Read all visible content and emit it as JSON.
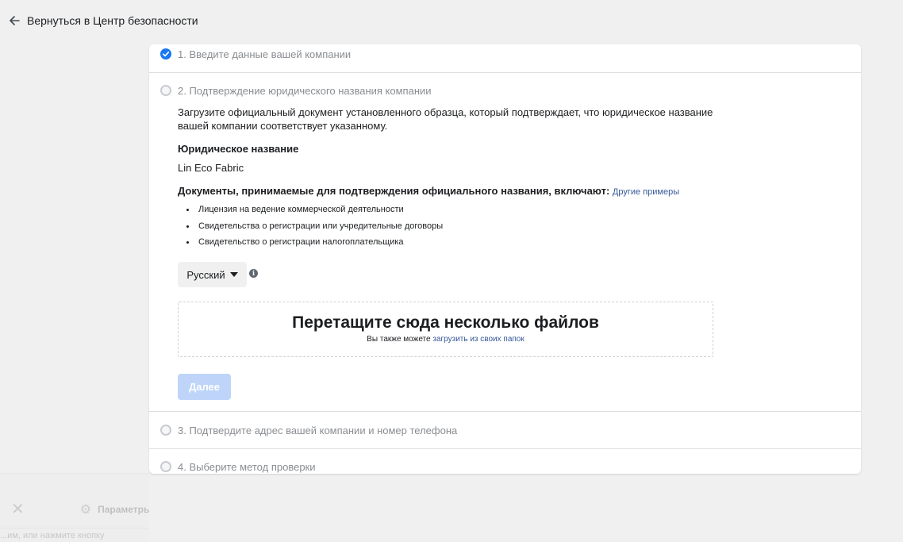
{
  "nav": {
    "back_label": "Вернуться в Центр безопасности"
  },
  "steps": [
    {
      "label": "1. Введите данные вашей компании",
      "status": "completed"
    },
    {
      "label": "2. Подтверждение юридического названия компании",
      "status": "active"
    },
    {
      "label": "3. Подтвердите адрес вашей компании и номер телефона",
      "status": "pending"
    },
    {
      "label": "4. Выберите метод проверки",
      "status": "pending"
    }
  ],
  "step2": {
    "intro": "Загрузите официальный документ установленного образца, который подтверждает, что юридическое название вашей компании соответствует указанному.",
    "legal_name_label": "Юридическое название",
    "legal_name_value": "Lin Eco Fabric",
    "docs_label": "Документы, принимаемые для подтверждения официального названия, включают:",
    "more_examples_link": "Другие примеры",
    "documents": [
      "Лицензия на ведение коммерческой деятельности",
      "Свидетельства о регистрации или учредительные договоры",
      "Свидетельство о регистрации налогоплательщика"
    ],
    "language_select": {
      "value": "Русский"
    },
    "dropzone": {
      "title": "Перетащите сюда несколько файлов",
      "subtitle_prefix": "Вы также можете ",
      "subtitle_link": "загрузить из своих папок"
    },
    "next_button": "Далее"
  },
  "background": {
    "params_label": "Параметры",
    "hint_text": "...им, или нажмите кнопку"
  },
  "colors": {
    "accent": "#1877f2",
    "link": "#365899",
    "button_disabled": "#bed5f9",
    "page_bg": "#f0f0f0"
  }
}
